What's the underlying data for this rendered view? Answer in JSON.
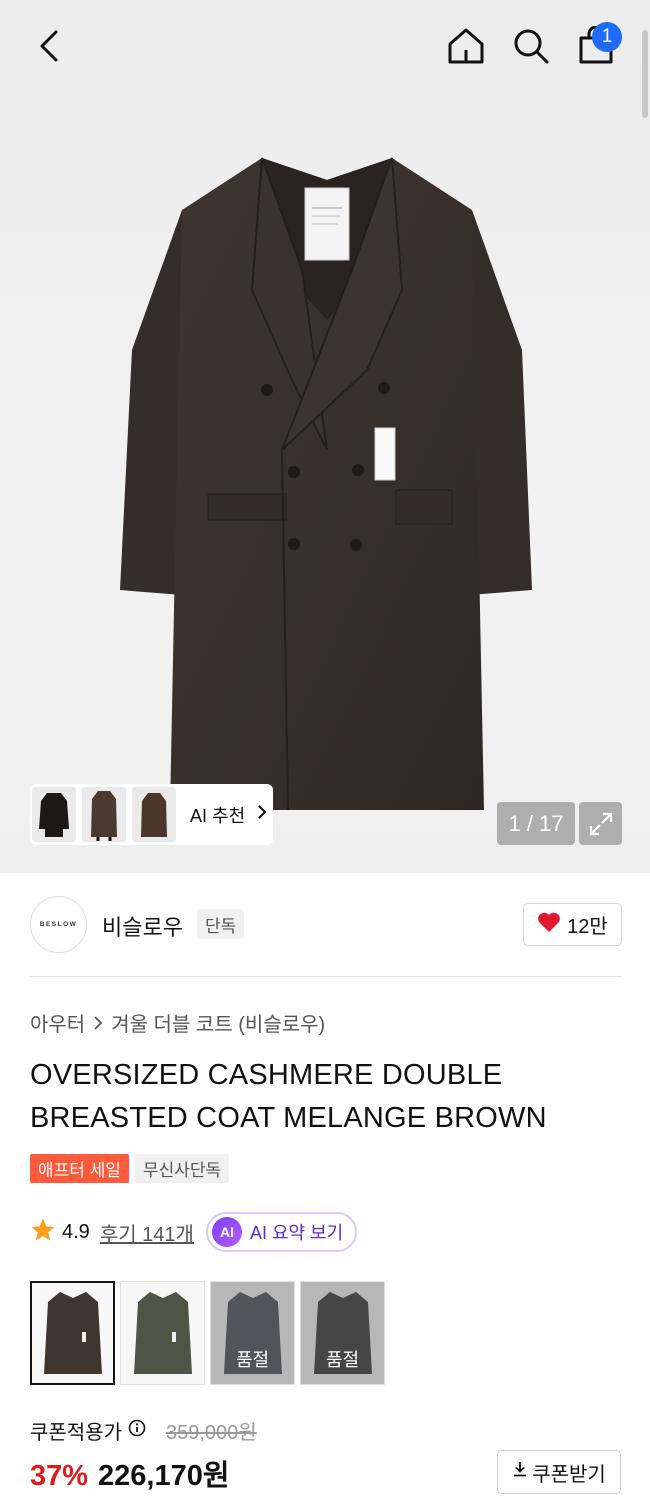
{
  "header": {
    "cart_count": "1"
  },
  "gallery": {
    "counter": "1 / 17",
    "ai_recommend_label": "AI 추천"
  },
  "brand": {
    "logo_text": "BESLOW",
    "name": "비슬로우",
    "tag": "단독",
    "likes": "12만"
  },
  "breadcrumb": {
    "category": "아우터",
    "subcategory": "겨울 더블 코트 (비슬로우)"
  },
  "product": {
    "title": "OVERSIZED CASHMERE DOUBLE BREASTED COAT MELANGE BROWN",
    "tags": [
      "애프터 세일",
      "무신사단독"
    ],
    "rating": "4.9",
    "reviews": "후기 141개",
    "ai_summary_icon": "AI",
    "ai_summary_label": "AI 요약 보기",
    "swatches": [
      {
        "color": "#3f3630",
        "soldout": ""
      },
      {
        "color": "#4f5544",
        "soldout": ""
      },
      {
        "color": "#2b313d",
        "soldout": "품절"
      },
      {
        "color": "#151515",
        "soldout": "품절"
      }
    ]
  },
  "price": {
    "coupon_label": "쿠폰적용가",
    "original": "359,000원",
    "discount": "37%",
    "final": "226,170원",
    "coupon_button": "쿠폰받기"
  },
  "colors": {
    "accent_blue": "#1f6bff",
    "sale_red": "#e01a1a",
    "heart_red": "#e5172f",
    "star_orange": "#ff9d1c",
    "ai_purple": "#5b2bd6"
  }
}
